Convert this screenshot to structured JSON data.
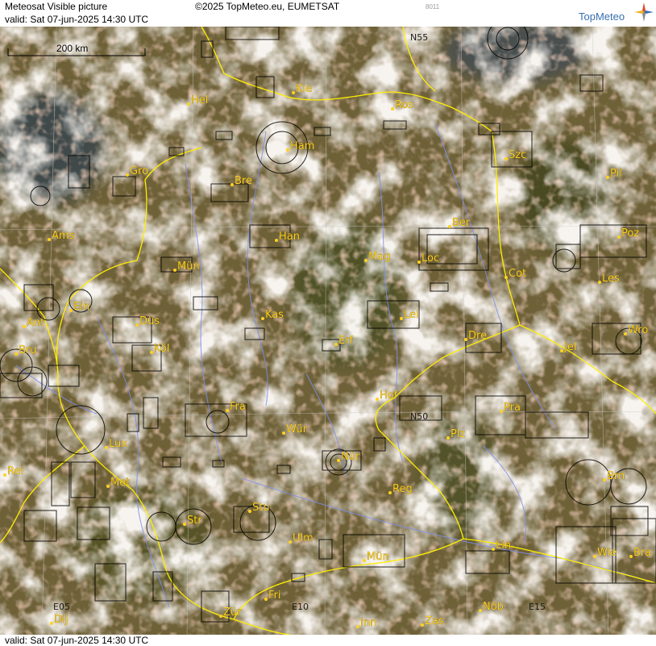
{
  "header": {
    "title": "Meteosat Visible picture",
    "valid": "valid:  Sat  07-jun-2025  14:30 UTC",
    "copyright": "©2025 TopMeteo.eu, EUMETSAT",
    "code": "8011",
    "brand": "TopMeteo",
    "logo_icon": "compass-star-icon"
  },
  "footer": {
    "valid": "valid:  Sat  07-jun-2025  14:30 UTC"
  },
  "scale_bar": {
    "label": "200 km"
  },
  "grid_labels": [
    {
      "text": "N55"
    },
    {
      "text": "N50"
    },
    {
      "text": "E05"
    },
    {
      "text": "E10"
    },
    {
      "text": "E15"
    }
  ],
  "cities": [
    {
      "name": "Hel"
    },
    {
      "name": "Kie"
    },
    {
      "name": "Ros"
    },
    {
      "name": "Ham"
    },
    {
      "name": "Szc"
    },
    {
      "name": "Gro"
    },
    {
      "name": "Bre"
    },
    {
      "name": "Pil"
    },
    {
      "name": "Ams"
    },
    {
      "name": "Han"
    },
    {
      "name": "Ber"
    },
    {
      "name": "Poz"
    },
    {
      "name": "Mün"
    },
    {
      "name": "Mag"
    },
    {
      "name": "Loc"
    },
    {
      "name": "Cot"
    },
    {
      "name": "Les"
    },
    {
      "name": "Ein"
    },
    {
      "name": "Kas"
    },
    {
      "name": "Lei"
    },
    {
      "name": "Ant"
    },
    {
      "name": "Düs"
    },
    {
      "name": "Dre"
    },
    {
      "name": "Wro"
    },
    {
      "name": "Bru"
    },
    {
      "name": "Köl"
    },
    {
      "name": "Erf"
    },
    {
      "name": "Jel"
    },
    {
      "name": "Hof"
    },
    {
      "name": "Fra"
    },
    {
      "name": "Pra"
    },
    {
      "name": "Wür"
    },
    {
      "name": "Plz"
    },
    {
      "name": "Lux"
    },
    {
      "name": "Nür"
    },
    {
      "name": "Rei"
    },
    {
      "name": "Met"
    },
    {
      "name": "Reg"
    },
    {
      "name": "Brn"
    },
    {
      "name": "Stu"
    },
    {
      "name": "Str"
    },
    {
      "name": "Ulm"
    },
    {
      "name": "Mün"
    },
    {
      "name": "Lin"
    },
    {
      "name": "Wie"
    },
    {
      "name": "Bra"
    },
    {
      "name": "Fri"
    },
    {
      "name": "Nöb"
    },
    {
      "name": "Dij"
    },
    {
      "name": "Zür"
    },
    {
      "name": "Inn"
    },
    {
      "name": "Zas"
    }
  ],
  "colors": {
    "city_label": "#ffd21f",
    "border": "#ffee00",
    "river": "#7d8ff0",
    "grid": "#c8c8c8",
    "restricted_zone": "#000000",
    "brand": "#3a6fb0"
  }
}
